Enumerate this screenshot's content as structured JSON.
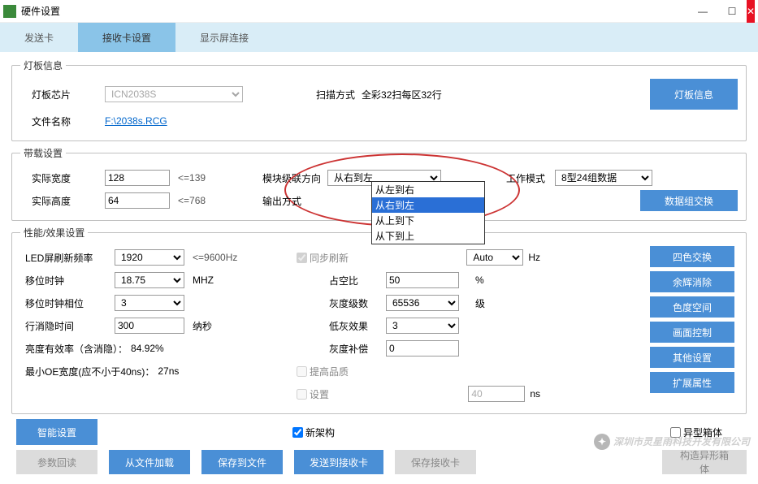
{
  "titlebar": {
    "title": "硬件设置"
  },
  "tabs": {
    "t1": "发送卡",
    "t2": "接收卡设置",
    "t3": "显示屏连接"
  },
  "group1": {
    "legend": "灯板信息",
    "chip_lbl": "灯板芯片",
    "chip_val": "ICN2038S",
    "scan_lbl": "扫描方式",
    "scan_val": "全彩32扫每区32行",
    "file_lbl": "文件名称",
    "file_val": "F:\\2038s.RCG",
    "info_btn": "灯板信息"
  },
  "group2": {
    "legend": "带载设置",
    "w_lbl": "实际宽度",
    "w_val": "128",
    "w_hint": "<=139",
    "h_lbl": "实际高度",
    "h_val": "64",
    "h_hint": "<=768",
    "cascade_lbl": "模块级联方向",
    "cascade_sel": "从右到左",
    "output_lbl": "输出方式",
    "opts": {
      "o1": "从左到右",
      "o2": "从右到左",
      "o3": "从上到下",
      "o4": "从下到上"
    },
    "mode_lbl": "工作模式",
    "mode_val": "8型24组数据",
    "swap_btn": "数据组交换"
  },
  "group3": {
    "legend": "性能/效果设置",
    "refresh_lbl": "LED屏刷新频率",
    "refresh_val": "1920",
    "refresh_hint": "<=9600Hz",
    "sync_cb": "同步刷新",
    "auto_val": "Auto",
    "hz": "Hz",
    "shift_lbl": "移位时钟",
    "shift_val": "18.75",
    "shift_unit": "MHZ",
    "duty_lbl": "占空比",
    "duty_val": "50",
    "pct": "%",
    "gray_lbl": "灰度级数",
    "gray_val": "65536",
    "gray_unit": "级",
    "phase_lbl": "移位时钟相位",
    "phase_val": "3",
    "lowgray_lbl": "低灰效果",
    "lowgray_val": "3",
    "blank_lbl": "行消隐时间",
    "blank_val": "300",
    "blank_unit": "纳秒",
    "comp_lbl": "灰度补偿",
    "comp_val": "0",
    "eff_lbl": "亮度有效率（含消隐）：",
    "eff_val": "84.92%",
    "hq_cb": "提高品质",
    "oe_lbl": "最小OE宽度(应不小于40ns)：",
    "oe_val": "27ns",
    "set_cb": "设置",
    "set_val": "40",
    "ns": "ns",
    "b1": "四色交换",
    "b2": "余辉消除",
    "b3": "色度空间",
    "b4": "画面控制",
    "b5": "其他设置",
    "b6": "扩展属性"
  },
  "bottom": {
    "smart_btn": "智能设置",
    "arch_cb": "新架构",
    "irreg_cb": "异型箱体",
    "build_btn": "构造异形箱体",
    "read_btn": "参数回读",
    "load_btn": "从文件加载",
    "save_btn": "保存到文件",
    "send_btn": "发送到接收卡",
    "store_btn": "保存接收卡"
  },
  "watermark": "深圳市灵星雨科技开发有限公司"
}
